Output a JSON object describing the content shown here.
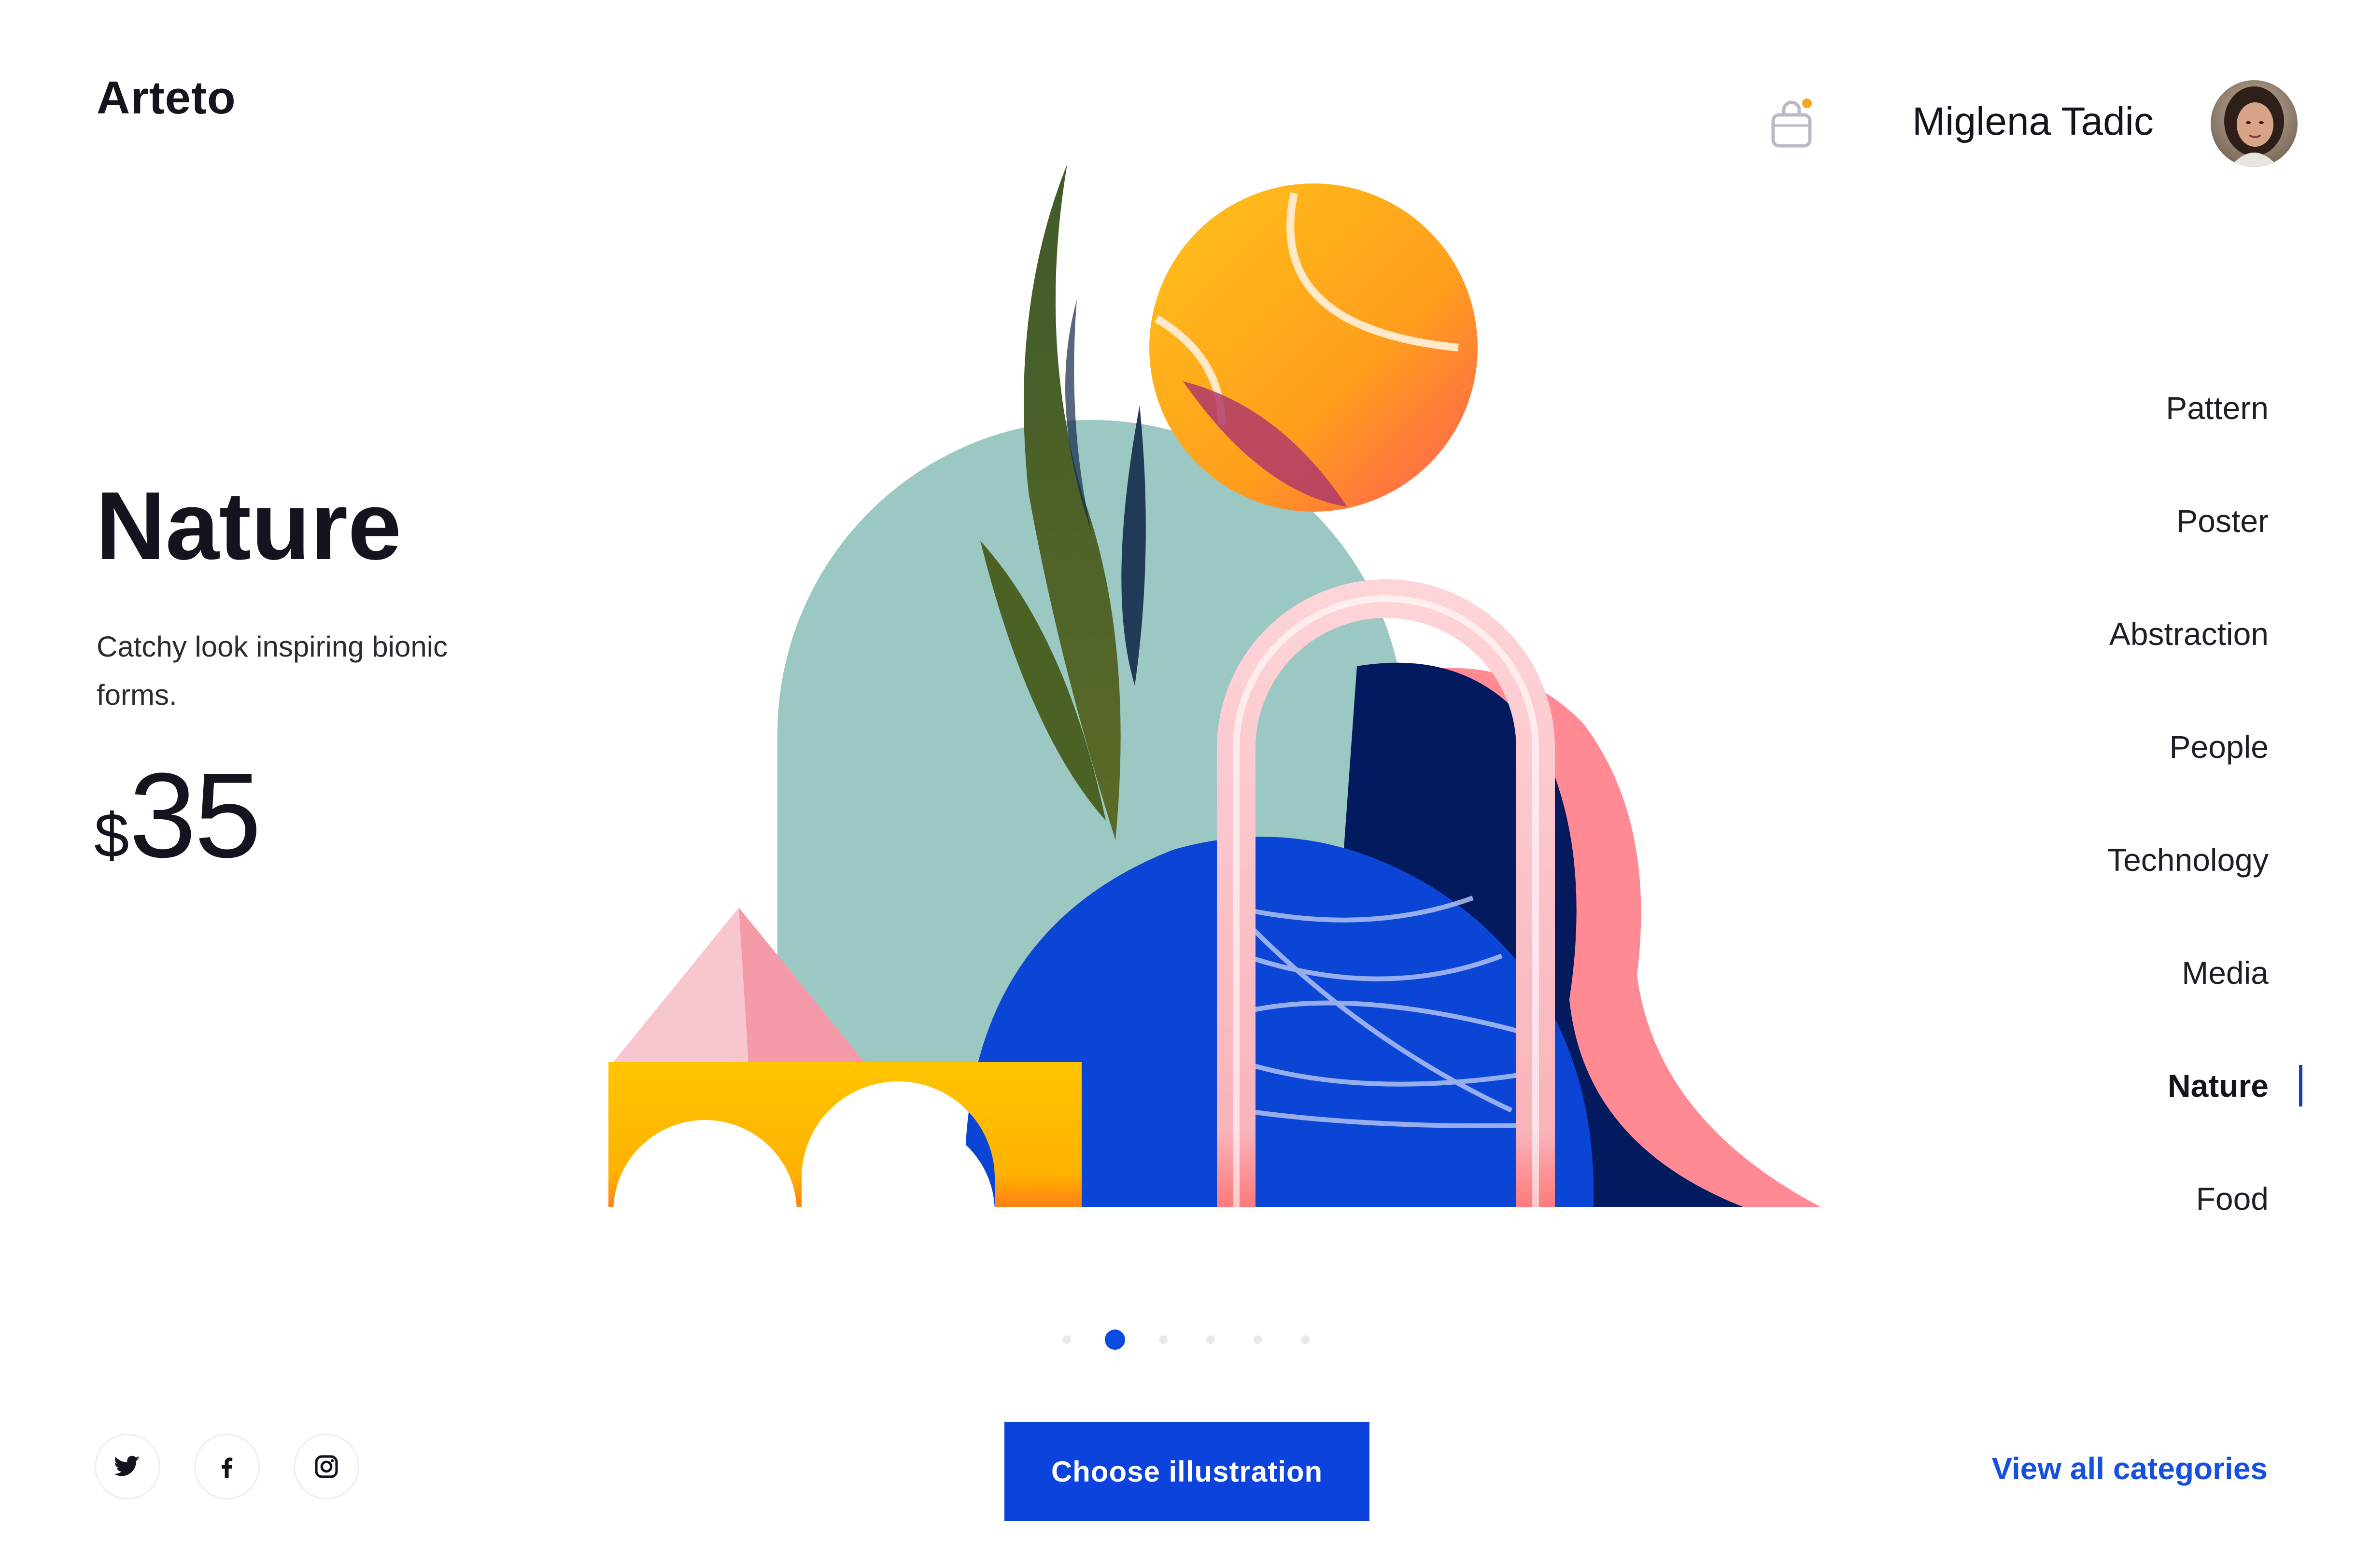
{
  "brand": {
    "name": "Arteto"
  },
  "user": {
    "name": "Miglena Tadic"
  },
  "hero": {
    "title": "Nature",
    "description": "Catchy look inspiring bionic forms.",
    "price_currency": "$",
    "price_value": "35"
  },
  "categories": {
    "items": [
      {
        "label": "Pattern",
        "active": false
      },
      {
        "label": "Poster",
        "active": false
      },
      {
        "label": "Abstraction",
        "active": false
      },
      {
        "label": "People",
        "active": false
      },
      {
        "label": "Technology",
        "active": false
      },
      {
        "label": "Media",
        "active": false
      },
      {
        "label": "Nature",
        "active": true
      },
      {
        "label": "Food",
        "active": false
      }
    ]
  },
  "carousel": {
    "total": 6,
    "current_index": 1
  },
  "actions": {
    "choose_label": "Choose illustration",
    "view_all_label": "View all categories"
  },
  "social": {
    "icons": [
      "twitter-icon",
      "facebook-icon",
      "instagram-icon"
    ]
  },
  "colors": {
    "accent": "#0b43dc",
    "link": "#1550e0",
    "text": "#14141f"
  }
}
